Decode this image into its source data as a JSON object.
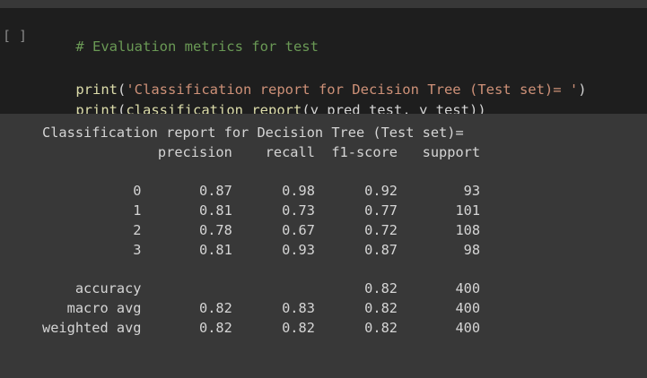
{
  "cell": {
    "run_indicator": "[ ]",
    "code_lines": {
      "comment": "# Evaluation metrics for test",
      "line2_fn": "print",
      "line2_open": "(",
      "line2_str": "'Classification report for Decision Tree (Test set)= '",
      "line2_close": ")",
      "line3_fn": "print",
      "line3_open": "(",
      "line3_inner_fn": "classification_report",
      "line3_args": "(y_pred_test, y_test))"
    }
  },
  "output": {
    "text": "Classification report for Decision Tree (Test set)=\n              precision    recall  f1-score   support\n\n           0       0.87      0.98      0.92        93\n           1       0.81      0.73      0.77       101\n           2       0.78      0.67      0.72       108\n           3       0.81      0.93      0.87        98\n\n    accuracy                           0.82       400\n   macro avg       0.82      0.83      0.82       400\nweighted avg       0.82      0.82      0.82       400"
  },
  "colors": {
    "cell_background": "#1e1e1e",
    "output_background": "#383838",
    "comment": "#6a9955",
    "function": "#dcdcaa",
    "string": "#ce9178",
    "text": "#d4d4d4"
  }
}
